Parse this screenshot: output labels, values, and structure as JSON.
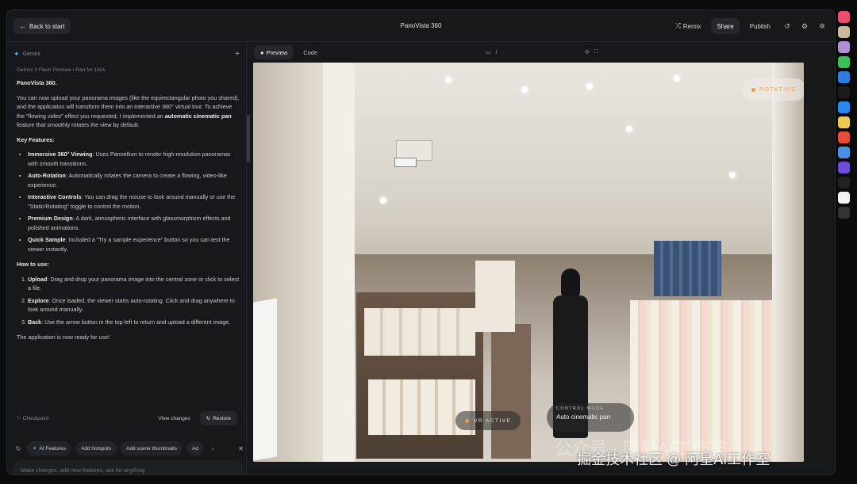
{
  "topbar": {
    "back_label": "Back to start",
    "title": "PanoVista 360",
    "remix_label": "Remix",
    "share_label": "Share",
    "publish_label": "Publish"
  },
  "sidebar": {
    "model_header": "Gemini",
    "meta": "Gemini 3 Flash Preview  •  Ran for 163s",
    "title": "PanoVista 360.",
    "intro_1": "You can now upload your panorama images (like the equirectangular photo you shared), and the application will transform them into an interactive 360° virtual tour. To achieve the \"flowing video\" effect you requested, I implemented an ",
    "intro_bold": "automatic cinematic pan",
    "intro_2": " feature that smoothly rotates the view by default.",
    "features_heading": "Key Features:",
    "features": [
      {
        "title": "Immersive 360° Viewing",
        "text": ": Uses Pannellum to render high-resolution panoramas with smooth transitions."
      },
      {
        "title": "Auto-Rotation",
        "text": ": Automatically rotates the camera to create a flowing, video-like experience."
      },
      {
        "title": "Interactive Controls",
        "text": ": You can drag the mouse to look around manually or use the \"Static/Rotating\" toggle to control the motion."
      },
      {
        "title": "Premium Design",
        "text": ": A dark, atmospheric interface with glassmorphism effects and polished animations."
      },
      {
        "title": "Quick Sample",
        "text": ": Included a \"Try a sample experience\" button so you can test the viewer instantly."
      }
    ],
    "howto_heading": "How to use:",
    "steps": [
      {
        "title": "Upload",
        "text": ": Drag and drop your panorama image into the central zone or click to select a file."
      },
      {
        "title": "Explore",
        "text": ": Once loaded, the viewer starts auto-rotating. Click and drag anywhere to look around manually."
      },
      {
        "title": "Back",
        "text": ": Use the arrow button in the top-left to return and upload a different image."
      }
    ],
    "closing": "The application is now ready for use!",
    "checkpoint_label": "Checkpoint",
    "view_changes_label": "View changes",
    "restore_label": "Restore",
    "chips": [
      "AI Features",
      "Add hotspots",
      "Add scene thumbnails",
      "Ad"
    ],
    "input_placeholder": "Make changes, add new features, ask for anything"
  },
  "preview": {
    "tab_preview": "Preview",
    "tab_code": "Code",
    "url_path": "/",
    "rotating_badge": "ROTATING",
    "vr_badge": "VR ACTIVE",
    "control_mode_label": "CONTROL MODE",
    "control_mode_value": "Auto cinematic pan",
    "watermark_faint": "公众号 · 阿星AI工作室",
    "watermark": "掘金技术社区 @ 阿星AI工作室"
  },
  "colors": {
    "accent_blue": "#6aa0ff",
    "rotating_orange": "#e7a45a",
    "panel_bg": "#17181a"
  }
}
